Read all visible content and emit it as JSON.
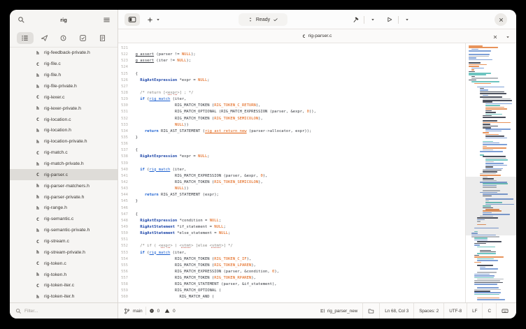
{
  "sidebar": {
    "title": "rig",
    "filter_placeholder": "Filter...",
    "files": [
      {
        "kind": "h",
        "name": "rig-feedback-private.h",
        "selected": false
      },
      {
        "kind": "C",
        "name": "rig-file.c",
        "selected": false
      },
      {
        "kind": "h",
        "name": "rig-file.h",
        "selected": false
      },
      {
        "kind": "h",
        "name": "rig-file-private.h",
        "selected": false
      },
      {
        "kind": "C",
        "name": "rig-lexer.c",
        "selected": false
      },
      {
        "kind": "h",
        "name": "rig-lexer-private.h",
        "selected": false
      },
      {
        "kind": "C",
        "name": "rig-location.c",
        "selected": false
      },
      {
        "kind": "h",
        "name": "rig-location.h",
        "selected": false
      },
      {
        "kind": "h",
        "name": "rig-location-private.h",
        "selected": false
      },
      {
        "kind": "C",
        "name": "rig-match.c",
        "selected": false
      },
      {
        "kind": "h",
        "name": "rig-match-private.h",
        "selected": false
      },
      {
        "kind": "C",
        "name": "rig-parser.c",
        "selected": true
      },
      {
        "kind": "h",
        "name": "rig-parser-matchers.h",
        "selected": false
      },
      {
        "kind": "h",
        "name": "rig-parser-private.h",
        "selected": false
      },
      {
        "kind": "h",
        "name": "rig-range.h",
        "selected": false
      },
      {
        "kind": "C",
        "name": "rig-semantic.c",
        "selected": false
      },
      {
        "kind": "h",
        "name": "rig-semantic-private.h",
        "selected": false
      },
      {
        "kind": "C",
        "name": "rig-stream.c",
        "selected": false
      },
      {
        "kind": "h",
        "name": "rig-stream-private.h",
        "selected": false
      },
      {
        "kind": "C",
        "name": "rig-token.c",
        "selected": false
      },
      {
        "kind": "h",
        "name": "rig-token.h",
        "selected": false
      },
      {
        "kind": "C",
        "name": "rig-token-iter.c",
        "selected": false
      },
      {
        "kind": "h",
        "name": "rig-token-iter.h",
        "selected": false
      }
    ]
  },
  "header": {
    "omnibar_status": "Ready"
  },
  "tabbar": {
    "file_kind": "C",
    "file_name": "rig-parser.c"
  },
  "editor": {
    "syntax_colors": {
      "plain": "#36393f",
      "keyword": "#1a5fd0",
      "type": "#1b44a7",
      "constant": "#e05d0c",
      "comment": "#82807c"
    },
    "lines": [
      {
        "n": 521,
        "s": []
      },
      {
        "n": 522,
        "s": [
          [
            "p",
            "  "
          ],
          [
            "u",
            "g_assert"
          ],
          [
            "p",
            " (parser != "
          ],
          [
            "c",
            "NULL"
          ],
          [
            "p",
            ");"
          ]
        ]
      },
      {
        "n": 523,
        "s": [
          [
            "p",
            "  "
          ],
          [
            "u",
            "g_assert"
          ],
          [
            "p",
            " (iter != "
          ],
          [
            "c",
            "NULL"
          ],
          [
            "p",
            ");"
          ]
        ]
      },
      {
        "n": 524,
        "s": []
      },
      {
        "n": 525,
        "s": [
          [
            "p",
            "  {"
          ]
        ]
      },
      {
        "n": 526,
        "s": [
          [
            "p",
            "    "
          ],
          [
            "t",
            "RigAstExpression"
          ],
          [
            "p",
            " *expr = "
          ],
          [
            "c",
            "NULL"
          ],
          [
            "p",
            ";"
          ]
        ]
      },
      {
        "n": 527,
        "s": []
      },
      {
        "n": 528,
        "s": [
          [
            "p",
            "    "
          ],
          [
            "cm",
            "/* return [<"
          ],
          [
            "cs",
            "expr"
          ],
          [
            "cm",
            ">] ; */"
          ]
        ]
      },
      {
        "n": 529,
        "s": [
          [
            "p",
            "    "
          ],
          [
            "k",
            "if"
          ],
          [
            "p",
            " ("
          ],
          [
            "fb",
            "rig_match"
          ],
          [
            "p",
            " (iter,"
          ]
        ]
      },
      {
        "n": 530,
        "s": [
          [
            "p",
            "                   RIG_MATCH_TOKEN ("
          ],
          [
            "c",
            "RIG_TOKEN_C_RETURN"
          ],
          [
            "p",
            "),"
          ]
        ]
      },
      {
        "n": 531,
        "s": [
          [
            "p",
            "                   RIG_MATCH_OPTIONAL (RIG_MATCH_EXPRESSION (parser, &expr, "
          ],
          [
            "c",
            "0"
          ],
          [
            "p",
            ")),"
          ]
        ]
      },
      {
        "n": 532,
        "s": [
          [
            "p",
            "                   RIG_MATCH_TOKEN ("
          ],
          [
            "c",
            "RIG_TOKEN_SEMICOLON"
          ],
          [
            "p",
            "),"
          ]
        ]
      },
      {
        "n": 533,
        "s": [
          [
            "p",
            "                   "
          ],
          [
            "c",
            "NULL"
          ],
          [
            "p",
            "))"
          ]
        ]
      },
      {
        "n": 534,
        "s": [
          [
            "p",
            "      "
          ],
          [
            "k",
            "return"
          ],
          [
            "p",
            " RIG_AST_STATEMENT ("
          ],
          [
            "lo",
            "rig_ast_return_new"
          ],
          [
            "p",
            " (parser->allocator, expr));"
          ]
        ]
      },
      {
        "n": 535,
        "s": [
          [
            "p",
            "  }"
          ]
        ]
      },
      {
        "n": 536,
        "s": []
      },
      {
        "n": 537,
        "s": [
          [
            "p",
            "  {"
          ]
        ]
      },
      {
        "n": 538,
        "s": [
          [
            "p",
            "    "
          ],
          [
            "t",
            "RigAstExpression"
          ],
          [
            "p",
            " *expr = "
          ],
          [
            "c",
            "NULL"
          ],
          [
            "p",
            ";"
          ]
        ]
      },
      {
        "n": 539,
        "s": []
      },
      {
        "n": 540,
        "s": [
          [
            "p",
            "    "
          ],
          [
            "k",
            "if"
          ],
          [
            "p",
            " ("
          ],
          [
            "fb",
            "rig_match"
          ],
          [
            "p",
            " (iter,"
          ]
        ]
      },
      {
        "n": 541,
        "s": [
          [
            "p",
            "                   RIG_MATCH_EXPRESSION (parser, &expr, "
          ],
          [
            "c",
            "0"
          ],
          [
            "p",
            "),"
          ]
        ]
      },
      {
        "n": 542,
        "s": [
          [
            "p",
            "                   RIG_MATCH_TOKEN ("
          ],
          [
            "c",
            "RIG_TOKEN_SEMICOLON"
          ],
          [
            "p",
            "),"
          ]
        ]
      },
      {
        "n": 543,
        "s": [
          [
            "p",
            "                   "
          ],
          [
            "c",
            "NULL"
          ],
          [
            "p",
            "))"
          ]
        ]
      },
      {
        "n": 544,
        "s": [
          [
            "p",
            "      "
          ],
          [
            "k",
            "return"
          ],
          [
            "p",
            " RIG_AST_STATEMENT (expr);"
          ]
        ]
      },
      {
        "n": 545,
        "s": [
          [
            "p",
            "  }"
          ]
        ]
      },
      {
        "n": 546,
        "s": []
      },
      {
        "n": 547,
        "s": [
          [
            "p",
            "  {"
          ]
        ]
      },
      {
        "n": 548,
        "s": [
          [
            "p",
            "    "
          ],
          [
            "t",
            "RigAstExpression"
          ],
          [
            "p",
            " *condition = "
          ],
          [
            "c",
            "NULL"
          ],
          [
            "p",
            ";"
          ]
        ]
      },
      {
        "n": 549,
        "s": [
          [
            "p",
            "    "
          ],
          [
            "t",
            "RigAstStatement"
          ],
          [
            "p",
            " *if_statement = "
          ],
          [
            "c",
            "NULL"
          ],
          [
            "p",
            ";"
          ]
        ]
      },
      {
        "n": 550,
        "s": [
          [
            "p",
            "    "
          ],
          [
            "t",
            "RigAstStatement"
          ],
          [
            "p",
            " *else_statement = "
          ],
          [
            "c",
            "NULL"
          ],
          [
            "p",
            ";"
          ]
        ]
      },
      {
        "n": 551,
        "s": []
      },
      {
        "n": 552,
        "s": [
          [
            "p",
            "    "
          ],
          [
            "cm",
            "/* if ( <"
          ],
          [
            "cs",
            "expr"
          ],
          [
            "cm",
            "> ) <"
          ],
          [
            "cs",
            "stmt"
          ],
          [
            "cm",
            "> [else <"
          ],
          [
            "cs",
            "stmt"
          ],
          [
            "cm",
            ">] */"
          ]
        ]
      },
      {
        "n": 553,
        "s": [
          [
            "p",
            "    "
          ],
          [
            "k",
            "if"
          ],
          [
            "p",
            " ("
          ],
          [
            "fb",
            "rig_match"
          ],
          [
            "p",
            " (iter,"
          ]
        ]
      },
      {
        "n": 554,
        "s": [
          [
            "p",
            "                   RIG_MATCH_TOKEN ("
          ],
          [
            "c",
            "RIG_TOKEN_C_IF"
          ],
          [
            "p",
            "),"
          ]
        ]
      },
      {
        "n": 555,
        "s": [
          [
            "p",
            "                   RIG_MATCH_TOKEN ("
          ],
          [
            "c",
            "RIG_TOKEN_LPAREN"
          ],
          [
            "p",
            "),"
          ]
        ]
      },
      {
        "n": 556,
        "s": [
          [
            "p",
            "                   RIG_MATCH_EXPRESSION (parser, &condition, "
          ],
          [
            "c",
            "0"
          ],
          [
            "p",
            "),"
          ]
        ]
      },
      {
        "n": 557,
        "s": [
          [
            "p",
            "                   RIG_MATCH_TOKEN ("
          ],
          [
            "c",
            "RIG_TOKEN_RPAREN"
          ],
          [
            "p",
            "),"
          ]
        ]
      },
      {
        "n": 558,
        "s": [
          [
            "p",
            "                   RIG_MATCH_STATEMENT (parser, &if_statement),"
          ]
        ]
      },
      {
        "n": 559,
        "s": [
          [
            "p",
            "                   RIG_MATCH_OPTIONAL ("
          ]
        ]
      },
      {
        "n": 560,
        "s": [
          [
            "p",
            "                     RIG_MATCH_AND ("
          ]
        ]
      }
    ]
  },
  "minimap": {
    "rows": 150,
    "seed": 1337,
    "palette": {
      "blue": "#7d9fd6",
      "dark": "#4a4f5c",
      "cyan": "#6cc4bf",
      "orange": "#e8935a",
      "gray": "#b3b7bd"
    }
  },
  "statusbar": {
    "branch": "main",
    "errors": "0",
    "warnings": "0",
    "symbol": "rig_parser_new",
    "position": "Ln 68, Col 3",
    "indentation": "Spaces: 2",
    "encoding": "UTF-8",
    "line_ending": "LF",
    "language": "C"
  }
}
